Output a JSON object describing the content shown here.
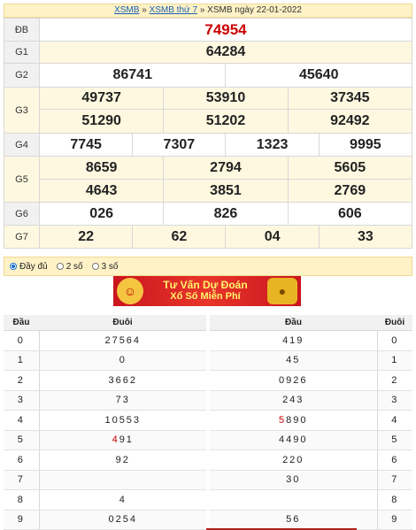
{
  "header": {
    "link1": "XSMB",
    "sep1": "»",
    "link2": "XSMB thứ 7",
    "sep2": "»",
    "title": "XSMB ngày 22-01-2022"
  },
  "results": {
    "db_label": "ĐB",
    "db": "74954",
    "g1_label": "G1",
    "g1": "64284",
    "g2_label": "G2",
    "g2": [
      "86741",
      "45640"
    ],
    "g3_label": "G3",
    "g3": [
      "49737",
      "53910",
      "37345",
      "51290",
      "51202",
      "92492"
    ],
    "g4_label": "G4",
    "g4": [
      "7745",
      "7307",
      "1323",
      "9995"
    ],
    "g5_label": "G5",
    "g5": [
      "8659",
      "2794",
      "5605",
      "4643",
      "3851",
      "2769"
    ],
    "g6_label": "G6",
    "g6": [
      "026",
      "826",
      "606"
    ],
    "g7_label": "G7",
    "g7": [
      "22",
      "62",
      "04",
      "33"
    ]
  },
  "options": [
    {
      "label": "Đầy đủ",
      "selected": true
    },
    {
      "label": "2 số",
      "selected": false
    },
    {
      "label": "3 số",
      "selected": false
    }
  ],
  "banner": {
    "line1": "Tư Vấn Dự Đoán",
    "line2": "Xổ Số Miễn Phí"
  },
  "loto_left": {
    "col1": "Đầu",
    "col2": "Đuôi",
    "rows": [
      {
        "key": "0",
        "val": "27564"
      },
      {
        "key": "1",
        "val": "0"
      },
      {
        "key": "2",
        "val": "3662"
      },
      {
        "key": "3",
        "val": "73"
      },
      {
        "key": "4",
        "val": "10553"
      },
      {
        "key": "5",
        "val": "491",
        "highlight": "4"
      },
      {
        "key": "6",
        "val": "92"
      },
      {
        "key": "7",
        "val": ""
      },
      {
        "key": "8",
        "val": "4"
      },
      {
        "key": "9",
        "val": "0254"
      }
    ]
  },
  "loto_right": {
    "col1": "Đầu",
    "col2": "Đuôi",
    "rows": [
      {
        "key": "0",
        "val": "419"
      },
      {
        "key": "1",
        "val": "45"
      },
      {
        "key": "2",
        "val": "0926"
      },
      {
        "key": "3",
        "val": "243"
      },
      {
        "key": "4",
        "val": "5890",
        "highlight": "5"
      },
      {
        "key": "5",
        "val": "4490"
      },
      {
        "key": "6",
        "val": "220"
      },
      {
        "key": "7",
        "val": "30"
      },
      {
        "key": "8",
        "val": ""
      },
      {
        "key": "9",
        "val": "56"
      }
    ]
  },
  "colors": {
    "accent": "#cc0000",
    "header_bg": "#fff2c6",
    "row_alt": "#fff8e0"
  }
}
